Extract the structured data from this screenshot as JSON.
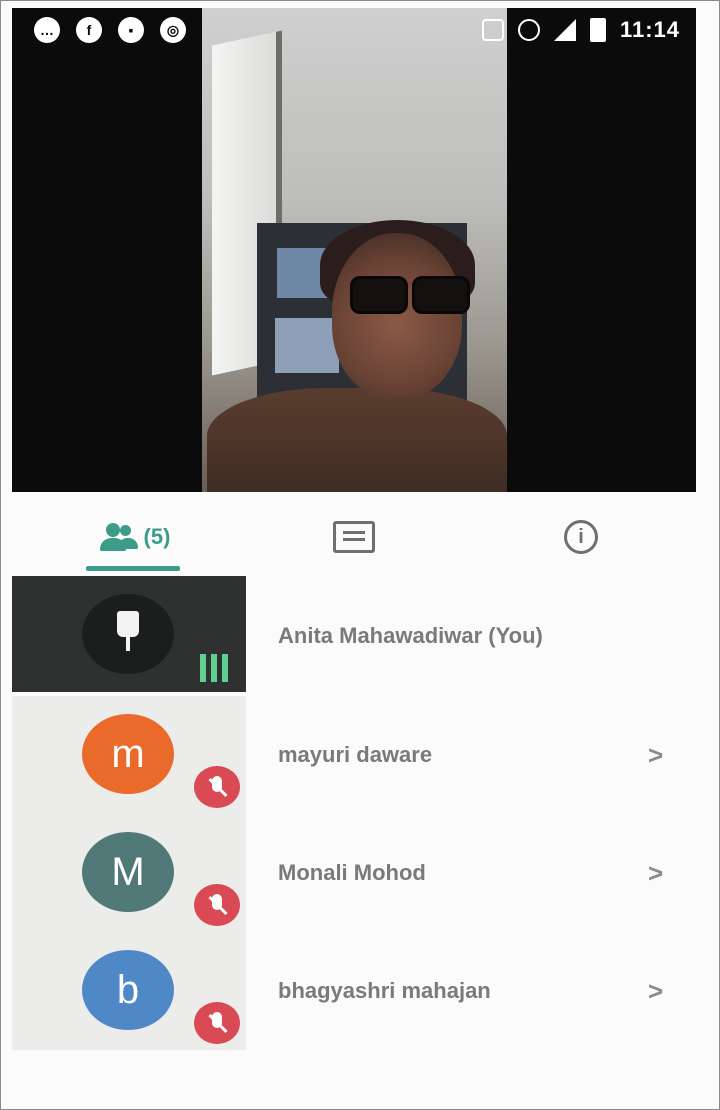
{
  "status_bar": {
    "time": "11:14",
    "left_icons": [
      "messenger-icon",
      "facebook-icon",
      "message-icon",
      "chrome-icon"
    ],
    "right_icons": [
      "cast-icon",
      "alarm-icon",
      "signal-4g-icon",
      "battery-icon"
    ]
  },
  "tabs": {
    "people_count": "(5)",
    "active": "people",
    "items": [
      "people-icon",
      "chat-icon",
      "info-icon"
    ]
  },
  "participants": [
    {
      "name": "Anita Mahawadiwar (You)",
      "initial": "",
      "avatar_color": "#1c1e1e",
      "pinned": true,
      "speaking": true
    },
    {
      "name": "mayuri daware",
      "initial": "m",
      "avatar_color": "#ea6a2b",
      "muted": true
    },
    {
      "name": "Monali Mohod",
      "initial": "M",
      "avatar_color": "#4f7877",
      "muted": true
    },
    {
      "name": "bhagyashri mahajan",
      "initial": "b",
      "avatar_color": "#4e88c7",
      "muted": true
    }
  ],
  "colors": {
    "accent": "#3c9c8a",
    "mute": "#d94a55",
    "level": "#5fd08f"
  }
}
